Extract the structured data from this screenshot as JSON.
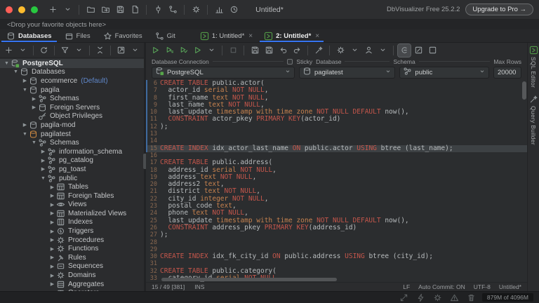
{
  "title_bar": {
    "title": "Untitled*",
    "app_version": "DbVisualizer Free 25.2.2",
    "upgrade_label": "Upgrade to Pro →",
    "toolbar_icons": [
      "plus",
      "chevron-down",
      "|",
      "folder",
      "folder-arrow",
      "floppy",
      "doc-floppy",
      "|",
      "plug",
      "branch",
      "|",
      "gear",
      "|",
      "chart",
      "clock"
    ]
  },
  "drop_bar": {
    "text": "<Drop your favorite objects here>"
  },
  "tab_bar": {
    "left_tabs": [
      {
        "label": "Databases",
        "icon": "db",
        "active": true
      },
      {
        "label": "Files",
        "icon": "files",
        "active": false
      },
      {
        "label": "Favorites",
        "icon": "star",
        "active": false
      },
      {
        "label": "Git",
        "icon": "branch",
        "active": false
      }
    ],
    "editor_tabs": [
      {
        "label": "1: Untitled*",
        "icon": "sql-tab",
        "close": "×",
        "active": false
      },
      {
        "label": "2: Untitled*",
        "icon": "sql-tab",
        "close": "×",
        "active": true
      }
    ]
  },
  "sidebar": {
    "toolbar_icons": [
      "plus",
      "chevron-down",
      "|",
      "refresh",
      "|",
      "funnel",
      "chevron-down",
      "|",
      "collapse",
      "|",
      "export",
      "chevron-down"
    ],
    "tree": [
      {
        "indent": 0,
        "arrow": "open",
        "icon": "conn",
        "label": "PostgreSQL",
        "bold": true,
        "selected": true
      },
      {
        "indent": 1,
        "arrow": "open",
        "icon": "db",
        "label": "Databases"
      },
      {
        "indent": 2,
        "arrow": "closed",
        "icon": "db",
        "label": "ecommerce",
        "extra": "(Default)"
      },
      {
        "indent": 2,
        "arrow": "open",
        "icon": "db",
        "label": "pagila"
      },
      {
        "indent": 3,
        "arrow": "closed",
        "icon": "schema",
        "label": "Schemas"
      },
      {
        "indent": 3,
        "arrow": "closed",
        "icon": "db",
        "label": "Foreign Servers"
      },
      {
        "indent": 3,
        "arrow": "none",
        "icon": "key",
        "label": "Object Privileges"
      },
      {
        "indent": 2,
        "arrow": "closed",
        "icon": "db",
        "label": "pagila-mod"
      },
      {
        "indent": 2,
        "arrow": "open",
        "icon": "db-orange",
        "label": "pagilatest"
      },
      {
        "indent": 3,
        "arrow": "open",
        "icon": "schema",
        "label": "Schemas"
      },
      {
        "indent": 4,
        "arrow": "closed",
        "icon": "schema",
        "label": "information_schema"
      },
      {
        "indent": 4,
        "arrow": "closed",
        "icon": "schema",
        "label": "pg_catalog"
      },
      {
        "indent": 4,
        "arrow": "closed",
        "icon": "schema",
        "label": "pg_toast"
      },
      {
        "indent": 4,
        "arrow": "open",
        "icon": "schema",
        "label": "public"
      },
      {
        "indent": 5,
        "arrow": "closed",
        "icon": "table",
        "label": "Tables"
      },
      {
        "indent": 5,
        "arrow": "closed",
        "icon": "table",
        "label": "Foreign Tables"
      },
      {
        "indent": 5,
        "arrow": "closed",
        "icon": "eye",
        "label": "Views"
      },
      {
        "indent": 5,
        "arrow": "closed",
        "icon": "table",
        "label": "Materialized Views"
      },
      {
        "indent": 5,
        "arrow": "closed",
        "icon": "index",
        "label": "Indexes"
      },
      {
        "indent": 5,
        "arrow": "closed",
        "icon": "trigger",
        "label": "Triggers"
      },
      {
        "indent": 5,
        "arrow": "closed",
        "icon": "gear",
        "label": "Procedures"
      },
      {
        "indent": 5,
        "arrow": "closed",
        "icon": "gear",
        "label": "Functions"
      },
      {
        "indent": 5,
        "arrow": "closed",
        "icon": "rule",
        "label": "Rules"
      },
      {
        "indent": 5,
        "arrow": "closed",
        "icon": "seq",
        "label": "Sequences"
      },
      {
        "indent": 5,
        "arrow": "closed",
        "icon": "gear",
        "label": "Domains"
      },
      {
        "indent": 5,
        "arrow": "closed",
        "icon": "agg",
        "label": "Aggregates"
      },
      {
        "indent": 5,
        "arrow": "closed",
        "icon": "op",
        "label": "Operators"
      }
    ]
  },
  "editor": {
    "toolbar_icons": [
      "play:green",
      "play-doc:green",
      "play-list:green",
      "play:green",
      "chevron-down",
      "|",
      "stop:dim",
      "|",
      "floppy",
      "floppy",
      "undo",
      "redo",
      "|",
      "wand",
      "|",
      "gear",
      "chevron-down",
      "person",
      "chevron-down",
      "|",
      "toggle-c:active",
      "edit-box",
      "box"
    ],
    "connection_row": {
      "labels": {
        "connection": "Database Connection",
        "sticky": "Sticky",
        "database": "Database",
        "schema": "Schema",
        "max_rows": "Max Rows"
      },
      "connection_value": "PostgreSQL",
      "database_value": "pagilatest",
      "schema_value": "public",
      "max_rows_value": "20000",
      "sticky_checked": false
    },
    "code": {
      "highlight_line": 15,
      "changed_lines": [
        6,
        7,
        8,
        9,
        10,
        11,
        12,
        13,
        14,
        15
      ],
      "lines": [
        {
          "n": 6,
          "tokens": [
            [
              "k",
              "CREATE TABLE "
            ],
            [
              "i",
              "public.actor("
            ]
          ]
        },
        {
          "n": 7,
          "tokens": [
            [
              "i",
              "  actor_id "
            ],
            [
              "t",
              "serial "
            ],
            [
              "k",
              "NOT NULL"
            ],
            [
              "i",
              ","
            ]
          ]
        },
        {
          "n": 8,
          "tokens": [
            [
              "i",
              "  first_name "
            ],
            [
              "t",
              "text "
            ],
            [
              "k",
              "NOT NULL"
            ],
            [
              "i",
              ","
            ]
          ]
        },
        {
          "n": 9,
          "tokens": [
            [
              "i",
              "  last_name "
            ],
            [
              "t",
              "text "
            ],
            [
              "k",
              "NOT NULL"
            ],
            [
              "i",
              ","
            ]
          ]
        },
        {
          "n": 10,
          "tokens": [
            [
              "i",
              "  last_update "
            ],
            [
              "t",
              "timestamp with time zone "
            ],
            [
              "k",
              "NOT NULL DEFAULT "
            ],
            [
              "i",
              "now(),"
            ]
          ]
        },
        {
          "n": 11,
          "tokens": [
            [
              "k",
              "  CONSTRAINT "
            ],
            [
              "i",
              "actor_pkey "
            ],
            [
              "k",
              "PRIMARY KEY"
            ],
            [
              "i",
              "(actor_id)"
            ]
          ]
        },
        {
          "n": 12,
          "tokens": [
            [
              "i",
              ");"
            ]
          ]
        },
        {
          "n": 13,
          "tokens": []
        },
        {
          "n": 14,
          "tokens": []
        },
        {
          "n": 15,
          "tokens": [
            [
              "k",
              "CREATE INDEX "
            ],
            [
              "i",
              "idx_actor_last_name "
            ],
            [
              "k",
              "ON "
            ],
            [
              "i",
              "public.actor "
            ],
            [
              "k",
              "USING "
            ],
            [
              "i",
              "btree (last_name);"
            ]
          ]
        },
        {
          "n": 16,
          "tokens": []
        },
        {
          "n": 17,
          "tokens": [
            [
              "k",
              "CREATE TABLE "
            ],
            [
              "i",
              "public.address("
            ]
          ]
        },
        {
          "n": 18,
          "tokens": [
            [
              "i",
              "  address_id "
            ],
            [
              "t",
              "serial "
            ],
            [
              "k",
              "NOT NULL"
            ],
            [
              "i",
              ","
            ]
          ]
        },
        {
          "n": 19,
          "tokens": [
            [
              "i",
              "  address "
            ],
            [
              "t",
              "text "
            ],
            [
              "k",
              "NOT NULL"
            ],
            [
              "i",
              ","
            ]
          ]
        },
        {
          "n": 20,
          "tokens": [
            [
              "i",
              "  address2 "
            ],
            [
              "t",
              "text"
            ],
            [
              "i",
              ","
            ]
          ]
        },
        {
          "n": 21,
          "tokens": [
            [
              "i",
              "  district "
            ],
            [
              "t",
              "text "
            ],
            [
              "k",
              "NOT NULL"
            ],
            [
              "i",
              ","
            ]
          ]
        },
        {
          "n": 22,
          "tokens": [
            [
              "i",
              "  city_id "
            ],
            [
              "t",
              "integer "
            ],
            [
              "k",
              "NOT NULL"
            ],
            [
              "i",
              ","
            ]
          ]
        },
        {
          "n": 23,
          "tokens": [
            [
              "i",
              "  postal_code "
            ],
            [
              "t",
              "text"
            ],
            [
              "i",
              ","
            ]
          ]
        },
        {
          "n": 24,
          "tokens": [
            [
              "i",
              "  phone "
            ],
            [
              "t",
              "text "
            ],
            [
              "k",
              "NOT NULL"
            ],
            [
              "i",
              ","
            ]
          ]
        },
        {
          "n": 25,
          "tokens": [
            [
              "i",
              "  last_update "
            ],
            [
              "t",
              "timestamp with time zone "
            ],
            [
              "k",
              "NOT NULL DEFAULT "
            ],
            [
              "i",
              "now(),"
            ]
          ]
        },
        {
          "n": 26,
          "tokens": [
            [
              "k",
              "  CONSTRAINT "
            ],
            [
              "i",
              "address_pkey "
            ],
            [
              "k",
              "PRIMARY KEY"
            ],
            [
              "i",
              "(address_id)"
            ]
          ]
        },
        {
          "n": 27,
          "tokens": [
            [
              "i",
              ");"
            ]
          ]
        },
        {
          "n": 28,
          "tokens": []
        },
        {
          "n": 29,
          "tokens": []
        },
        {
          "n": 30,
          "tokens": [
            [
              "k",
              "CREATE INDEX "
            ],
            [
              "i",
              "idx_fk_city_id "
            ],
            [
              "k",
              "ON "
            ],
            [
              "i",
              "public.address "
            ],
            [
              "k",
              "USING "
            ],
            [
              "i",
              "btree (city_id);"
            ]
          ]
        },
        {
          "n": 31,
          "tokens": []
        },
        {
          "n": 32,
          "tokens": [
            [
              "k",
              "CREATE TABLE "
            ],
            [
              "i",
              "public.category("
            ]
          ]
        },
        {
          "n": 33,
          "tokens": [
            [
              "i",
              "  category_id "
            ],
            [
              "t",
              "serial "
            ],
            [
              "k",
              "NOT NULL"
            ],
            [
              "i",
              ","
            ]
          ]
        }
      ]
    },
    "status": {
      "position": "15 / 49 [381]",
      "mode": "INS",
      "line_ending": "LF",
      "auto_commit": "Auto Commit: ON",
      "encoding": "UTF-8",
      "file": "Untitled*"
    }
  },
  "right_strip": {
    "tabs": [
      {
        "label": "SQL Editor",
        "icon": "sql-tab"
      },
      {
        "label": "Query Builder",
        "icon": "wand"
      }
    ]
  },
  "status_bar": {
    "icons": [
      "move",
      "bolt",
      "gear",
      "warn",
      "trash"
    ],
    "memory": "879M of 4096M"
  },
  "colors": {
    "accent_blue": "#3674f0",
    "keyword_red": "#c4564b",
    "type_orange": "#c8834f",
    "icon_green": "#5aa85a",
    "traffic": [
      "#ff5f57",
      "#febc2e",
      "#28c840"
    ]
  }
}
